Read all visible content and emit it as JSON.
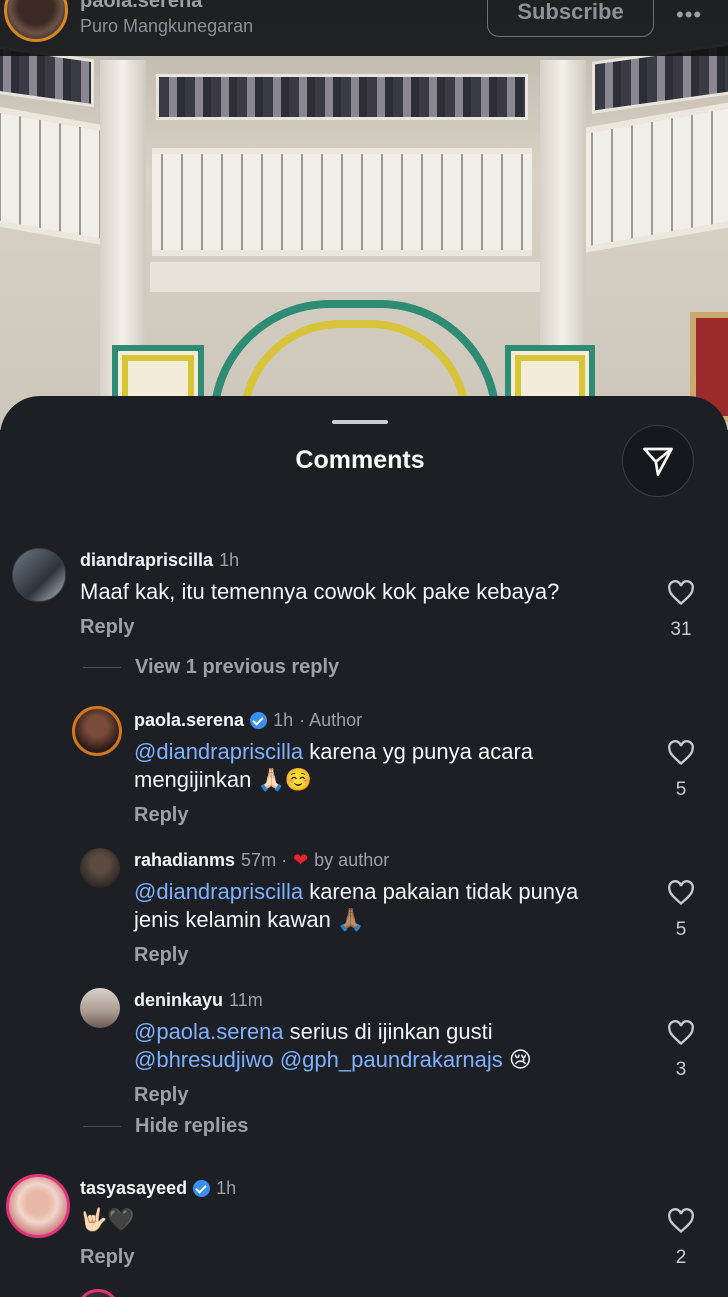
{
  "post": {
    "username": "paola.serena",
    "location": "Puro Mangkunegaran",
    "subscribe_label": "Subscribe",
    "more_label": "•••"
  },
  "sheet": {
    "title": "Comments"
  },
  "comments": [
    {
      "username": "diandrapriscilla",
      "time": "1h",
      "text": "Maaf kak, itu temennya cowok kok pake kebaya?",
      "reply_label": "Reply",
      "likes": "31"
    }
  ],
  "thread": {
    "view_previous_label": "View 1 previous reply",
    "hide_replies_label": "Hide replies"
  },
  "replies": [
    {
      "username": "paola.serena",
      "time": "1h",
      "extra": "· Author",
      "mention": "@diandrapriscilla",
      "text_line1": " karena yg punya acara",
      "text_line2": "mengijinkan",
      "emoji": "🙏🏻☺️",
      "reply_label": "Reply",
      "likes": "5"
    },
    {
      "username": "rahadianms",
      "time": "57m ·",
      "extra": "by author",
      "mention": "@diandrapriscilla",
      "text_line1": " karena pakaian tidak punya",
      "text_line2": "jenis kelamin kawan",
      "emoji": "🙏🏽",
      "reply_label": "Reply",
      "likes": "5"
    },
    {
      "username": "deninkayu",
      "time": "11m",
      "mention": "@paola.serena",
      "text_line1": " serius di ijinkan gusti",
      "mention2": "@bhresudjiwo @gph_paundrakarnajs",
      "emoji": "😢",
      "reply_label": "Reply",
      "likes": "3"
    }
  ],
  "comment2": {
    "username": "tasyasayeed",
    "time": "1h",
    "emoji": "🤟🏻🖤",
    "reply_label": "Reply",
    "likes": "2"
  }
}
